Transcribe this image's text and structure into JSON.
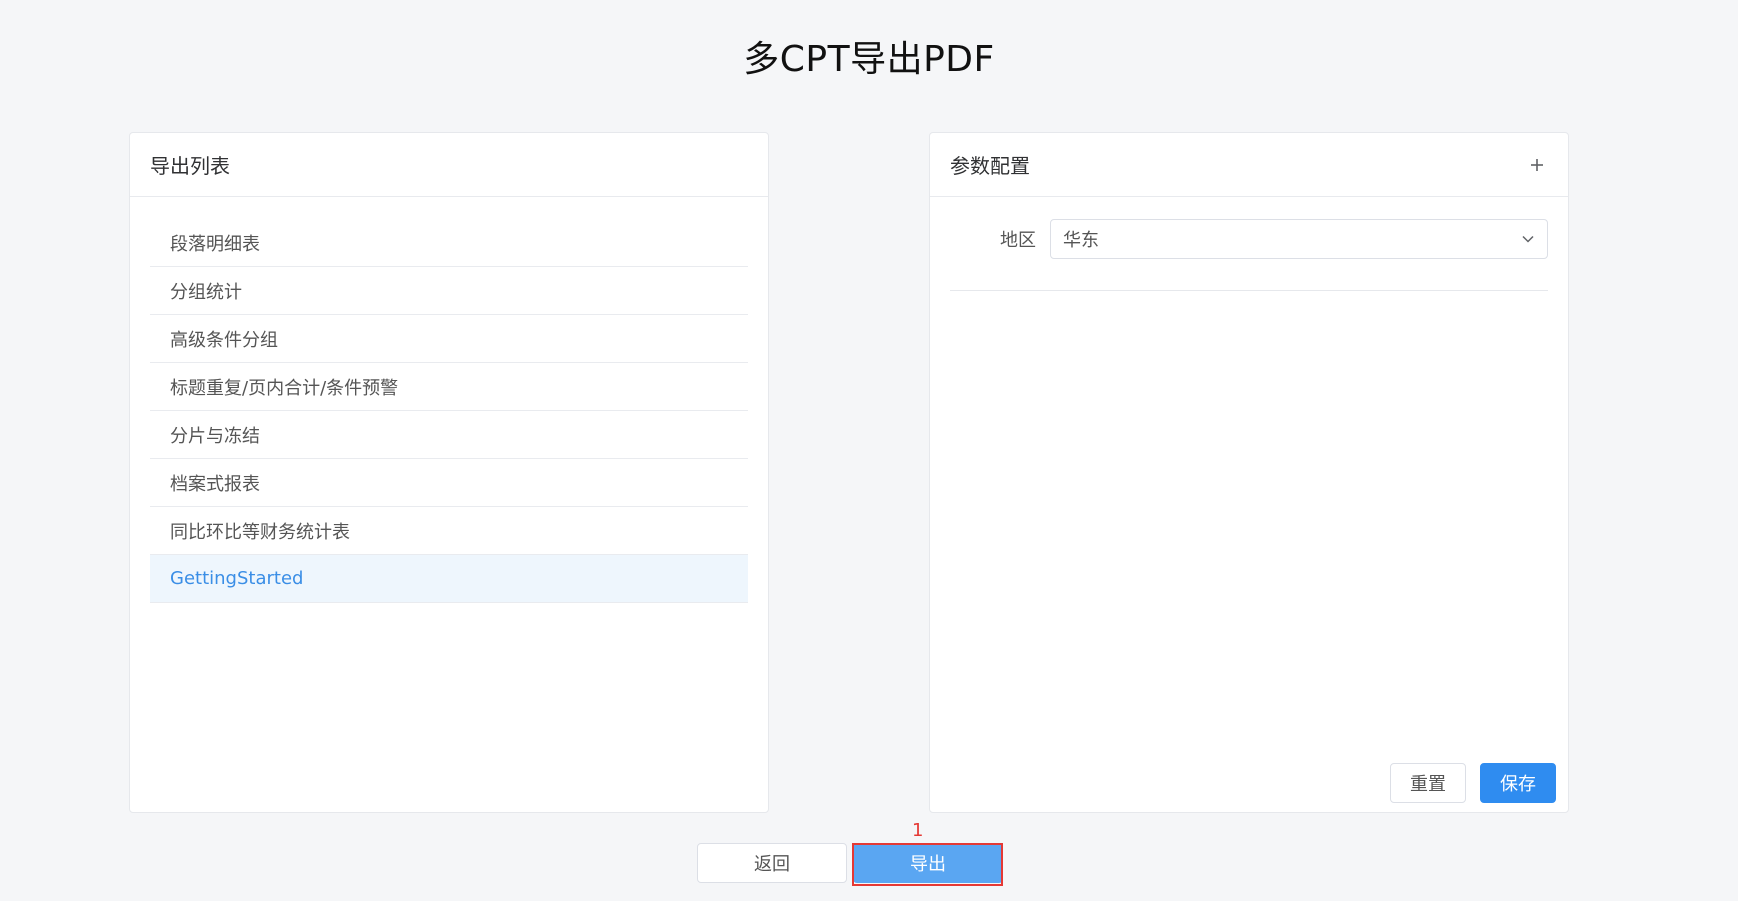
{
  "page": {
    "title": "多CPT导出PDF"
  },
  "left_panel": {
    "title": "导出列表",
    "items": [
      "段落明细表",
      "分组统计",
      "高级条件分组",
      "标题重复/页内合计/条件预警",
      "分片与冻结",
      "档案式报表",
      "同比环比等财务统计表",
      "GettingStarted"
    ],
    "selected_index": 7
  },
  "right_panel": {
    "title": "参数配置",
    "add_icon": "plus-icon",
    "region_label": "地区",
    "region_value": "华东",
    "reset_label": "重置",
    "save_label": "保存"
  },
  "footer": {
    "back_label": "返回",
    "export_label": "导出",
    "step_marker": "1"
  },
  "colors": {
    "primary": "#2f8cf0",
    "export_button": "#5aa6f2",
    "highlight": "#e53935",
    "selected_text": "#3a8ee6",
    "selected_bg": "#eef6fd"
  }
}
